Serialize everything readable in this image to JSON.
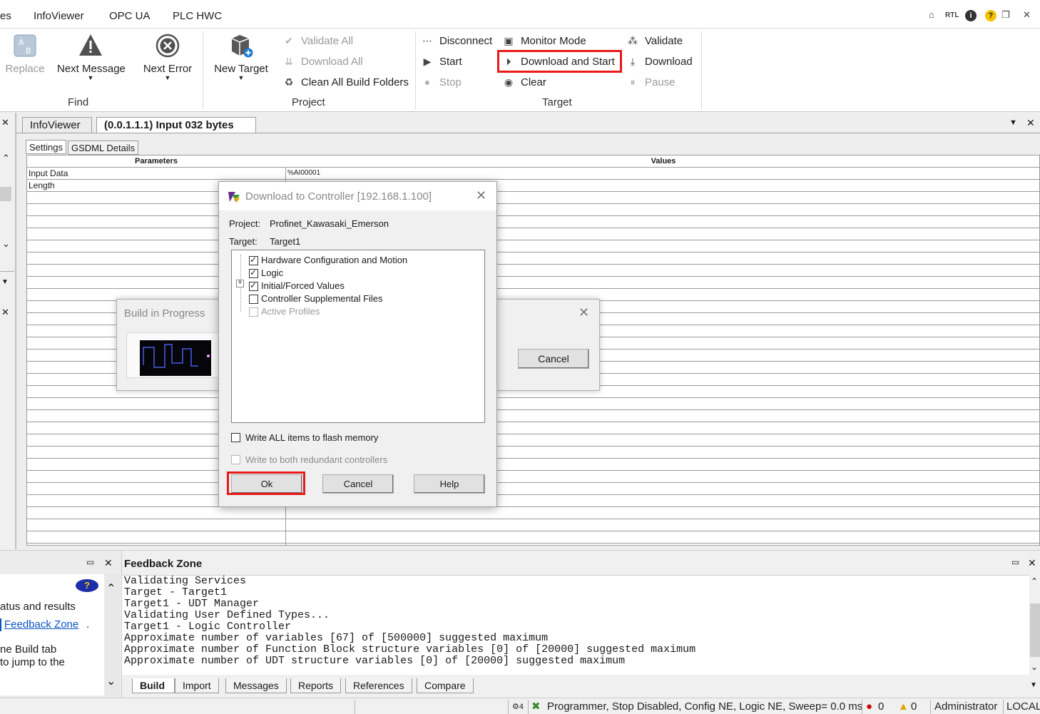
{
  "ribbon_tabs": [
    "es",
    "InfoViewer",
    "OPC UA",
    "PLC HWC"
  ],
  "title_icons": {
    "home": "⌂",
    "rtl": "RTL",
    "info": "i",
    "help": "?",
    "restore": "❐",
    "close": "✕"
  },
  "find_group": {
    "label": "Find",
    "replace": "Replace",
    "next_message": "Next Message",
    "next_error": "Next Error"
  },
  "project_group": {
    "label": "Project",
    "new_target": "New Target",
    "validate_all": "Validate All",
    "download_all": "Download All",
    "clean_all": "Clean All Build Folders"
  },
  "target_group": {
    "label": "Target",
    "disconnect": "Disconnect",
    "start": "Start",
    "stop": "Stop",
    "monitor_mode": "Monitor Mode",
    "download_and_start": "Download and Start",
    "clear": "Clear",
    "validate": "Validate",
    "download": "Download",
    "pause": "Pause"
  },
  "doc_tabs": [
    "InfoViewer",
    "(0.0.1.1.1) Input 032 bytes"
  ],
  "inner_tabs": [
    "Settings",
    "GSDML Details"
  ],
  "grid": {
    "headers": [
      "Parameters",
      "Values"
    ],
    "rows": [
      {
        "param": "Input Data",
        "value": "%AI00001"
      },
      {
        "param": "Length",
        "value": ""
      }
    ]
  },
  "build_dialog": {
    "title": "Build in Progress",
    "cancel": "Cancel"
  },
  "download_dialog": {
    "title": "Download to Controller [192.168.1.100]",
    "project_label": "Project:",
    "project_value": "Profinet_Kawasaki_Emerson",
    "target_label": "Target:",
    "target_value": "Target1",
    "items": [
      {
        "label": "Hardware Configuration and Motion",
        "checked": true,
        "enabled": true
      },
      {
        "label": "Logic",
        "checked": true,
        "enabled": true
      },
      {
        "label": "Initial/Forced Values",
        "checked": true,
        "enabled": true
      },
      {
        "label": "Controller Supplemental Files",
        "checked": false,
        "enabled": true
      },
      {
        "label": "Active Profiles",
        "checked": false,
        "enabled": false
      }
    ],
    "write_flash": "Write ALL items to flash memory",
    "write_redundant": "Write to both redundant controllers",
    "ok": "Ok",
    "cancel": "Cancel",
    "help": "Help"
  },
  "help_panel": {
    "line1": "atus and results",
    "link": "Feedback Zone",
    "link_suffix": ".",
    "line3": "ne Build tab",
    "line4": "to jump to the"
  },
  "feedback": {
    "title": "Feedback Zone",
    "lines": [
      "Validating Services",
      "Target - Target1",
      "Target1 - UDT Manager",
      "Validating User Defined Types...",
      "Target1 - Logic Controller",
      "Approximate number of variables [67] of [500000] suggested maximum",
      "Approximate number of Function Block structure variables [0] of [20000] suggested maximum",
      "Approximate number of UDT structure variables [0] of [20000] suggested maximum"
    ],
    "tabs": [
      "Build",
      "Import",
      "Messages",
      "Reports",
      "References",
      "Compare"
    ]
  },
  "status": {
    "count_icon_text": "4",
    "message": "Programmer, Stop Disabled, Config NE, Logic NE, Sweep=  0.0 ms",
    "errors": "0",
    "warnings": "0",
    "user": "Administrator",
    "mode": "LOCAL"
  },
  "colors": {
    "highlight": "#e81a1a",
    "link": "#0b55c4"
  }
}
